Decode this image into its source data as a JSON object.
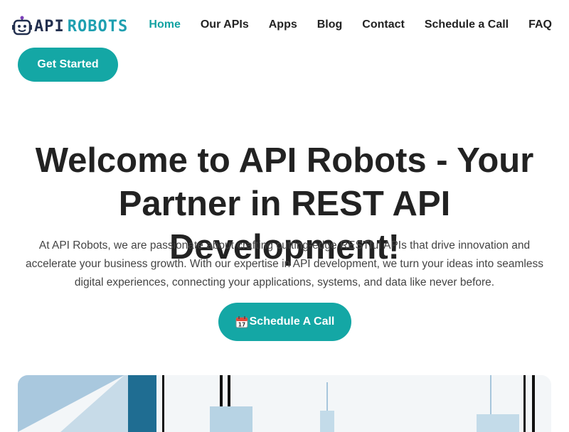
{
  "brand": {
    "logo_part1": "API",
    "logo_part2": "ROBOTS"
  },
  "nav": {
    "items": [
      {
        "label": "Home",
        "active": true
      },
      {
        "label": "Our APIs"
      },
      {
        "label": "Apps"
      },
      {
        "label": "Blog"
      },
      {
        "label": "Contact"
      },
      {
        "label": "Schedule a Call"
      },
      {
        "label": "FAQ"
      }
    ]
  },
  "header": {
    "cta_label": "Get Started"
  },
  "hero": {
    "title": "Welcome to API Robots - Your Partner in REST API Development!",
    "description": "At API Robots, we are passionate about crafting cutting-edge RESTful APIs that drive innovation and accelerate your business growth. With our expertise in API development, we turn your ideas into seamless digital experiences, connecting your applications, systems, and data like never before.",
    "cta_label": "Schedule A Call",
    "cta_icon": "calendar-icon"
  },
  "colors": {
    "accent": "#14a7a5",
    "nav_active": "#12a2a2",
    "text": "#222222",
    "logo_dark": "#23304f",
    "logo_teal": "#1e9fb0"
  }
}
